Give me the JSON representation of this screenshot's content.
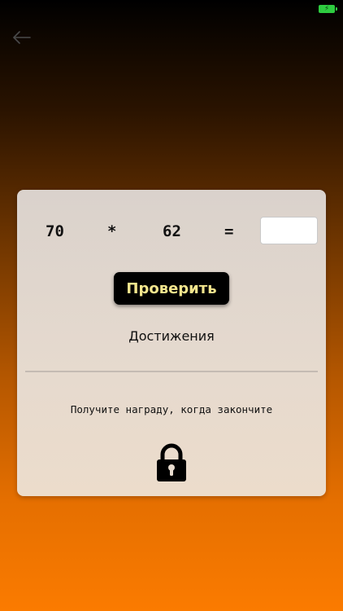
{
  "status_bar": {
    "battery_icon": "battery-charging-icon",
    "battery_color": "#2ecc40"
  },
  "navigation": {
    "back_icon": "arrow-left-icon"
  },
  "equation": {
    "operand_a": "70",
    "operator": "*",
    "operand_b": "62",
    "equals": "=",
    "answer_value": "",
    "answer_placeholder": ""
  },
  "check_button": {
    "label": "Проверить",
    "text_color": "#f2e58d",
    "background": "#000000"
  },
  "achievements": {
    "title": "Достижения",
    "reward_text": "Получите награду, когда закончите",
    "lock_icon": "padlock-locked-icon"
  }
}
